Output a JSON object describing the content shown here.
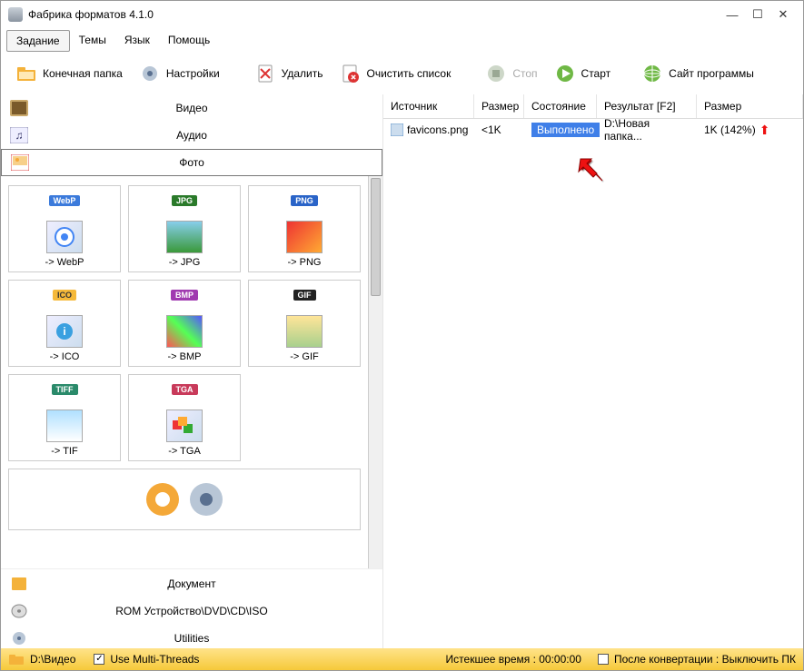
{
  "title": "Фабрика форматов 4.1.0",
  "menu": {
    "task": "Задание",
    "themes": "Темы",
    "lang": "Язык",
    "help": "Помощь"
  },
  "toolbar": {
    "dest": "Конечная папка",
    "settings": "Настройки",
    "delete": "Удалить",
    "clear": "Очистить список",
    "stop": "Стоп",
    "start": "Старт",
    "site": "Сайт программы"
  },
  "categories": {
    "video": "Видео",
    "audio": "Аудио",
    "photo": "Фото",
    "document": "Документ",
    "rom": "ROM Устройство\\DVD\\CD\\ISO",
    "utilities": "Utilities"
  },
  "formats": {
    "webp": "-> WebP",
    "jpg": "-> JPG",
    "png": "-> PNG",
    "ico": "-> ICO",
    "bmp": "-> BMP",
    "gif": "-> GIF",
    "tif": "-> TIF",
    "tga": "-> TGA"
  },
  "badges": {
    "webp": "WebP",
    "jpg": "JPG",
    "png": "PNG",
    "ico": "ICO",
    "bmp": "BMP",
    "gif": "GIF",
    "tif": "TIFF",
    "tga": "TGA"
  },
  "columns": {
    "source": "Источник",
    "size": "Размер",
    "state": "Состояние",
    "result": "Результат [F2]",
    "size2": "Размер"
  },
  "row": {
    "source": "favicons.png",
    "size": "<1K",
    "state": "Выполнено",
    "result": "D:\\Новая папка...",
    "size2": "1K  (142%)"
  },
  "status": {
    "path": "D:\\Видео",
    "multithreads": "Use Multi-Threads",
    "elapsed": "Истекшее время : 00:00:00",
    "after": "После конвертации : Выключить ПК"
  }
}
